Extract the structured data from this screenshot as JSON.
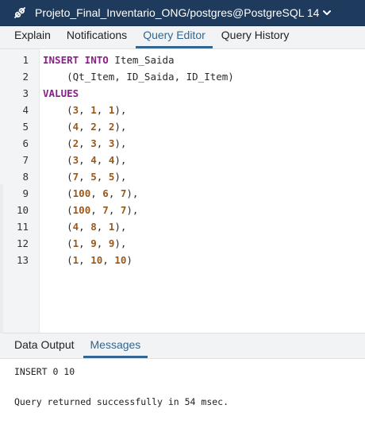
{
  "connection": {
    "title": "Projeto_Final_Inventario_ONG/postgres@PostgreSQL 14"
  },
  "tabs": [
    {
      "label": "Explain",
      "active": false
    },
    {
      "label": "Notifications",
      "active": false
    },
    {
      "label": "Query Editor",
      "active": true
    },
    {
      "label": "Query History",
      "active": false
    }
  ],
  "editor": {
    "line_numbers": [
      "1",
      "2",
      "3",
      "4",
      "5",
      "6",
      "7",
      "8",
      "9",
      "10",
      "11",
      "12",
      "13"
    ],
    "lines": [
      [
        {
          "t": "INSERT INTO",
          "c": "kw"
        },
        {
          "t": " Item_Saida",
          "c": ""
        }
      ],
      [
        {
          "t": "    (Qt_Item, ID_Saida, ID_Item)",
          "c": ""
        }
      ],
      [
        {
          "t": "VALUES",
          "c": "kw"
        }
      ],
      [
        {
          "t": "    (",
          "c": ""
        },
        {
          "t": "3",
          "c": "num"
        },
        {
          "t": ", ",
          "c": ""
        },
        {
          "t": "1",
          "c": "num"
        },
        {
          "t": ", ",
          "c": ""
        },
        {
          "t": "1",
          "c": "num"
        },
        {
          "t": "),",
          "c": ""
        }
      ],
      [
        {
          "t": "    (",
          "c": ""
        },
        {
          "t": "4",
          "c": "num"
        },
        {
          "t": ", ",
          "c": ""
        },
        {
          "t": "2",
          "c": "num"
        },
        {
          "t": ", ",
          "c": ""
        },
        {
          "t": "2",
          "c": "num"
        },
        {
          "t": "),",
          "c": ""
        }
      ],
      [
        {
          "t": "    (",
          "c": ""
        },
        {
          "t": "2",
          "c": "num"
        },
        {
          "t": ", ",
          "c": ""
        },
        {
          "t": "3",
          "c": "num"
        },
        {
          "t": ", ",
          "c": ""
        },
        {
          "t": "3",
          "c": "num"
        },
        {
          "t": "),",
          "c": ""
        }
      ],
      [
        {
          "t": "    (",
          "c": ""
        },
        {
          "t": "3",
          "c": "num"
        },
        {
          "t": ", ",
          "c": ""
        },
        {
          "t": "4",
          "c": "num"
        },
        {
          "t": ", ",
          "c": ""
        },
        {
          "t": "4",
          "c": "num"
        },
        {
          "t": "),",
          "c": ""
        }
      ],
      [
        {
          "t": "    (",
          "c": ""
        },
        {
          "t": "7",
          "c": "num"
        },
        {
          "t": ", ",
          "c": ""
        },
        {
          "t": "5",
          "c": "num"
        },
        {
          "t": ", ",
          "c": ""
        },
        {
          "t": "5",
          "c": "num"
        },
        {
          "t": "),",
          "c": ""
        }
      ],
      [
        {
          "t": "    (",
          "c": ""
        },
        {
          "t": "100",
          "c": "num"
        },
        {
          "t": ", ",
          "c": ""
        },
        {
          "t": "6",
          "c": "num"
        },
        {
          "t": ", ",
          "c": ""
        },
        {
          "t": "7",
          "c": "num"
        },
        {
          "t": "),",
          "c": ""
        }
      ],
      [
        {
          "t": "    (",
          "c": ""
        },
        {
          "t": "100",
          "c": "num"
        },
        {
          "t": ", ",
          "c": ""
        },
        {
          "t": "7",
          "c": "num"
        },
        {
          "t": ", ",
          "c": ""
        },
        {
          "t": "7",
          "c": "num"
        },
        {
          "t": "),",
          "c": ""
        }
      ],
      [
        {
          "t": "    (",
          "c": ""
        },
        {
          "t": "4",
          "c": "num"
        },
        {
          "t": ", ",
          "c": ""
        },
        {
          "t": "8",
          "c": "num"
        },
        {
          "t": ", ",
          "c": ""
        },
        {
          "t": "1",
          "c": "num"
        },
        {
          "t": "),",
          "c": ""
        }
      ],
      [
        {
          "t": "    (",
          "c": ""
        },
        {
          "t": "1",
          "c": "num"
        },
        {
          "t": ", ",
          "c": ""
        },
        {
          "t": "9",
          "c": "num"
        },
        {
          "t": ", ",
          "c": ""
        },
        {
          "t": "9",
          "c": "num"
        },
        {
          "t": "),",
          "c": ""
        }
      ],
      [
        {
          "t": "    (",
          "c": ""
        },
        {
          "t": "1",
          "c": "num"
        },
        {
          "t": ", ",
          "c": ""
        },
        {
          "t": "10",
          "c": "num"
        },
        {
          "t": ", ",
          "c": ""
        },
        {
          "t": "10",
          "c": "num"
        },
        {
          "t": ")",
          "c": ""
        }
      ]
    ]
  },
  "bottom_tabs": [
    {
      "label": "Data Output",
      "active": false
    },
    {
      "label": "Messages",
      "active": true
    }
  ],
  "messages": {
    "line1": "INSERT 0 10",
    "line2": "Query returned successfully in 54 msec."
  },
  "colors": {
    "header_bg": "#1e3a5c",
    "accent": "#326690",
    "keyword": "#8a1e8a",
    "number": "#98591c"
  },
  "icons": [
    "unplug-connection-icon",
    "chevron-down-icon"
  ]
}
